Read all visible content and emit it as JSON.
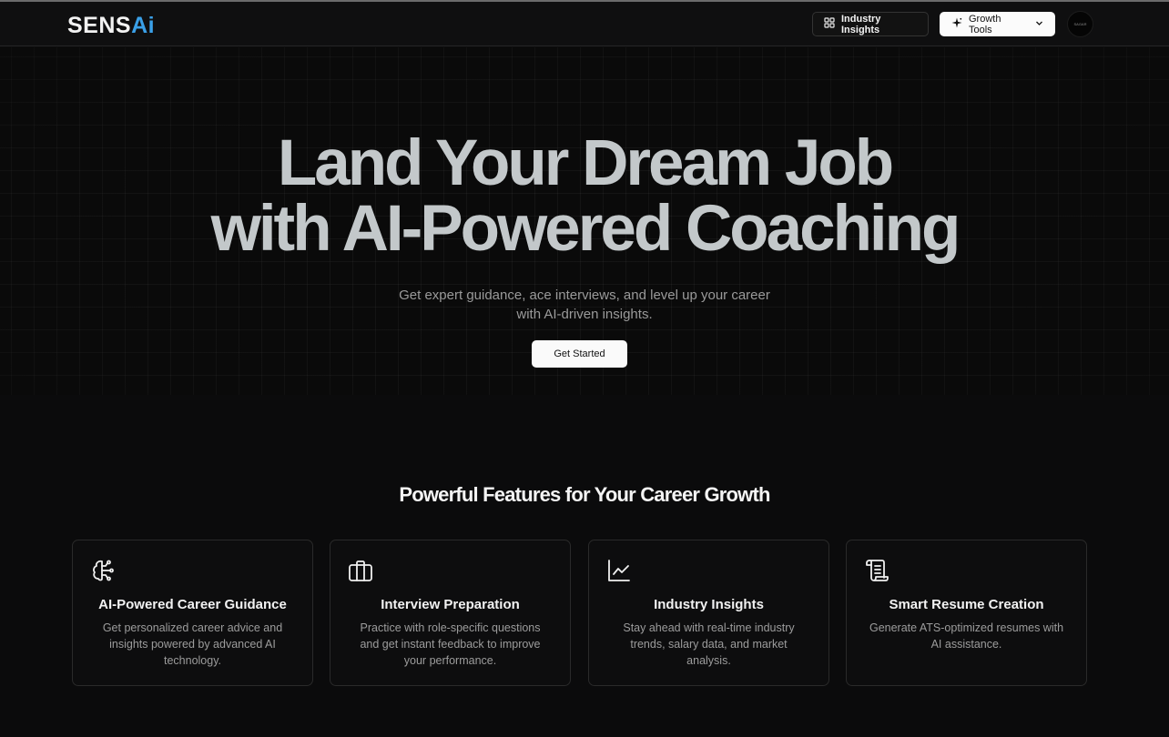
{
  "brand": {
    "logo_main": "SENS",
    "logo_accent": "Ai",
    "accent_color": "#3aa0e8"
  },
  "nav": {
    "industry_insights_label": "Industry Insights",
    "industry_insights_icon": "layout-dashboard-icon",
    "growth_tools_label": "Growth Tools",
    "growth_tools_icon": "sparkles-icon",
    "growth_tools_chevron": "chevron-down-icon",
    "avatar_text": "SAGAR"
  },
  "hero": {
    "title_line1": "Land Your Dream Job",
    "title_line2": "with AI-Powered Coaching",
    "subtitle_line1": "Get expert guidance, ace interviews, and level up your career",
    "subtitle_line2": "with AI-driven insights.",
    "cta_label": "Get Started"
  },
  "features": {
    "heading": "Powerful Features for Your Career Growth",
    "cards": [
      {
        "icon": "brain-circuit-icon",
        "title": "AI-Powered Career Guidance",
        "lines": [
          "Get personalized career advice and",
          "insights powered by advanced AI",
          "technology."
        ]
      },
      {
        "icon": "briefcase-icon",
        "title": "Interview Preparation",
        "lines": [
          "Practice with role-specific questions",
          "and get instant feedback to improve",
          "your performance."
        ]
      },
      {
        "icon": "line-chart-icon",
        "title": "Industry Insights",
        "lines": [
          "Stay ahead with real-time industry",
          "trends, salary data, and market",
          "analysis."
        ]
      },
      {
        "icon": "scroll-text-icon",
        "title": "Smart Resume Creation",
        "lines": [
          "Generate ATS-optimized resumes with",
          "AI assistance."
        ]
      }
    ]
  }
}
